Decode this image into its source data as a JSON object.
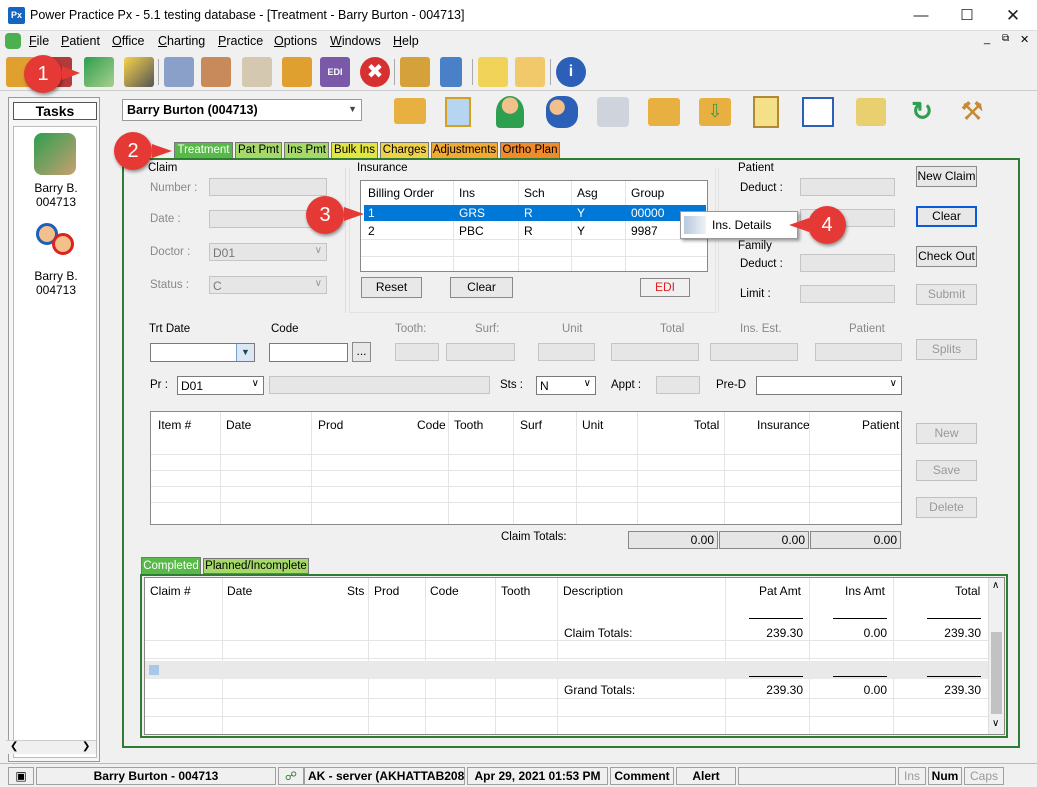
{
  "window": {
    "icon_text": "Px",
    "title": "Power Practice Px - 5.1 testing database - [Treatment - Barry Burton - 004713]"
  },
  "menu": [
    {
      "ul": "F",
      "rest": "ile"
    },
    {
      "ul": "P",
      "rest": "atient"
    },
    {
      "ul": "O",
      "rest": "ffice"
    },
    {
      "ul": "C",
      "rest": "harting"
    },
    {
      "ul": "P",
      "rest": "ractice"
    },
    {
      "ul": "O",
      "rest": "ptions"
    },
    {
      "ul": "W",
      "rest": "indows"
    },
    {
      "ul": "H",
      "rest": "elp"
    }
  ],
  "callouts": [
    "1",
    "2",
    "3",
    "4"
  ],
  "tasks": {
    "header": "Tasks",
    "patients": [
      {
        "name": "Barry B.",
        "id": "004713"
      },
      {
        "name": "Barry B.",
        "id": "004713"
      }
    ]
  },
  "patient_select": "Barry Burton (004713)",
  "tabs": [
    {
      "label": "Treatment",
      "color": "#57b947"
    },
    {
      "label": "Pat Pmt",
      "color": "#a6d86a"
    },
    {
      "label": "Ins Pmt",
      "color": "#a6d86a"
    },
    {
      "label": "Bulk Ins",
      "color": "#e3e545"
    },
    {
      "label": "Charges",
      "color": "#f0d24a"
    },
    {
      "label": "Adjustments",
      "color": "#f3aa33"
    },
    {
      "label": "Ortho Plan",
      "color": "#f08a2a"
    }
  ],
  "claim": {
    "section": "Claim",
    "number_label": "Number :",
    "date_label": "Date :",
    "doctor_label": "Doctor :",
    "doctor_value": "D01",
    "status_label": "Status :",
    "status_value": "C"
  },
  "insurance": {
    "section": "Insurance",
    "columns": [
      "Billing Order",
      "Ins",
      "Sch",
      "Asg",
      "Group"
    ],
    "rows": [
      [
        "1",
        "GRS",
        "R",
        "Y",
        "00000"
      ],
      [
        "2",
        "PBC",
        "R",
        "Y",
        "9987"
      ]
    ],
    "reset": "Reset",
    "clear": "Clear",
    "edi": "EDI"
  },
  "context_menu": {
    "item": "Ins. Details"
  },
  "patient_box": {
    "section": "Patient",
    "deduct_label": "Deduct :",
    "family_section": "Family",
    "family_deduct_label": "Deduct :",
    "limit_label": "Limit :"
  },
  "side_buttons": {
    "new_claim": "New Claim",
    "clear": "Clear",
    "check_out": "Check Out",
    "submit": "Submit",
    "splits": "Splits",
    "new": "New",
    "save": "Save",
    "delete": "Delete"
  },
  "entry": {
    "trt_date_label": "Trt Date",
    "code_label": "Code",
    "ellipsis": "...",
    "tooth_label": "Tooth:",
    "surf_label": "Surf:",
    "unit_label": "Unit",
    "total_label": "Total",
    "ins_est_label": "Ins. Est.",
    "patient_label": "Patient",
    "pr_label": "Pr :",
    "pr_value": "D01",
    "sts_label": "Sts :",
    "sts_value": "N",
    "appt_label": "Appt :",
    "pred_label": "Pre-D"
  },
  "items_grid": {
    "columns": [
      "Item #",
      "Date",
      "Prod",
      "Code",
      "Tooth",
      "Surf",
      "Unit",
      "Total",
      "Insurance",
      "Patient"
    ],
    "claim_totals_label": "Claim Totals:",
    "totals": [
      "0.00",
      "0.00",
      "0.00"
    ]
  },
  "bottom_tabs": [
    "Completed",
    "Planned/Incomplete"
  ],
  "completed_grid": {
    "columns": [
      "Claim #",
      "Date",
      "Sts",
      "Prod",
      "Code",
      "Tooth",
      "Description",
      "Pat Amt",
      "Ins Amt",
      "Total"
    ],
    "claim_totals": {
      "label": "Claim Totals:",
      "pat": "239.30",
      "ins": "0.00",
      "total": "239.30"
    },
    "grand_totals": {
      "label": "Grand Totals:",
      "pat": "239.30",
      "ins": "0.00",
      "total": "239.30"
    }
  },
  "statusbar": {
    "patient": "Barry Burton - 004713",
    "server": "AK - server (AKHATTAB208",
    "datetime": "Apr 29, 2021 01:53 PM",
    "comment": "Comment",
    "alert": "Alert",
    "ins": "Ins",
    "num": "Num",
    "caps": "Caps"
  },
  "colors": {
    "callout": "#e53935",
    "selection": "#0078d7",
    "panel_border": "#2e7d32"
  }
}
